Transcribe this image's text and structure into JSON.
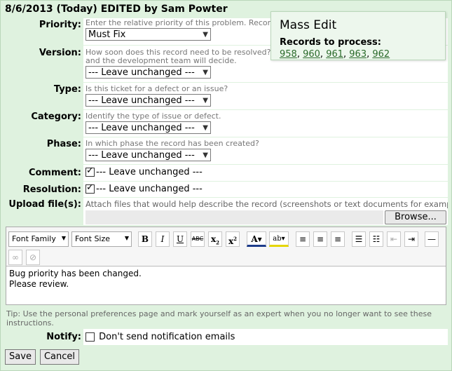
{
  "header": {
    "title": "8/6/2013 (Today) EDITED by Sam Powter"
  },
  "fields": {
    "priority": {
      "label": "Priority:",
      "hint": "Enter the relative priority of this problem. Record",
      "value": "Must Fix"
    },
    "version": {
      "label": "Version:",
      "hint1": "How soon does this record need to be resolved?",
      "hint2": "and the development team will decide.",
      "value": "--- Leave unchanged ---"
    },
    "type": {
      "label": "Type:",
      "hint": "Is this ticket for a defect or an issue?",
      "value": "--- Leave unchanged ---"
    },
    "category": {
      "label": "Category:",
      "hint": "Identify the type of issue or defect.",
      "value": "--- Leave unchanged ---"
    },
    "phase": {
      "label": "Phase:",
      "hint": "In which phase the record has been created?",
      "value": "--- Leave unchanged ---"
    },
    "comment": {
      "label": "Comment:",
      "text": "--- Leave unchanged ---",
      "checked": true
    },
    "resolution": {
      "label": "Resolution:",
      "text": "--- Leave unchanged ---",
      "checked": true
    },
    "upload": {
      "label": "Upload file(s):",
      "hint": "Attach files that would help describe the record (screenshots or text documents for example).",
      "browse_label": "Browse..."
    }
  },
  "editor": {
    "font_family": "Font Family",
    "font_size": "Font Size",
    "line1": "Bug priority has been changed.",
    "line2": "Please review."
  },
  "tip": "Tip: Use the personal preferences page and mark yourself as an expert when you no longer want to see these instructions.",
  "notify": {
    "label": "Notify:",
    "text": "Don't send notification emails",
    "checked": false
  },
  "buttons": {
    "save": "Save",
    "cancel": "Cancel"
  },
  "popup": {
    "title": "Mass Edit",
    "subtitle": "Records to process:",
    "records": [
      "958",
      "960",
      "961",
      "963",
      "962"
    ]
  }
}
